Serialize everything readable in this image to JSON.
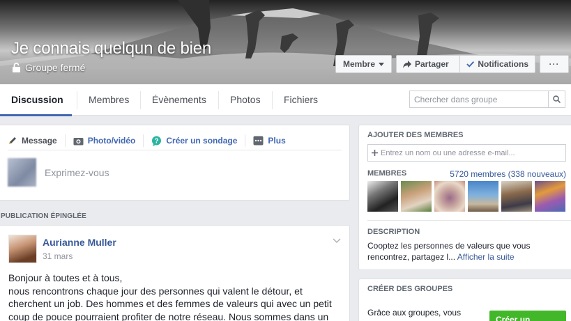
{
  "group": {
    "title": "Je connais quelqun de bien",
    "privacy": "Groupe fermé"
  },
  "cover_buttons": {
    "member": "Membre",
    "share": "Partager",
    "notifications": "Notifications",
    "more": "···"
  },
  "tabs": {
    "items": [
      "Discussion",
      "Membres",
      "Évènements",
      "Photos",
      "Fichiers"
    ],
    "active": "Discussion",
    "search_placeholder": "Chercher dans groupe"
  },
  "composer": {
    "tabs": [
      "Message",
      "Photo/vidéo",
      "Créer un sondage",
      "Plus"
    ],
    "placeholder": "Exprimez-vous"
  },
  "pinned": {
    "label": "PUBLICATION ÉPINGLÉE",
    "author": "Aurianne Muller",
    "date": "31 mars",
    "text_lines": [
      "Bonjour à toutes et à tous,",
      "nous rencontrons chaque jour des personnes qui valent le détour, et",
      "cherchent un job. Des hommes et des femmes de valeurs qui avec un petit",
      "coup de pouce pourraient profiter de notre réseau. Nous sommes dans un"
    ]
  },
  "sidebar": {
    "add_members_heading": "AJOUTER DES MEMBRES",
    "add_members_placeholder": "Entrez un nom ou une adresse e-mail...",
    "members_heading": "MEMBRES",
    "members_count": "5720 membres (338 nouveaux)",
    "description_heading": "DESCRIPTION",
    "description_text": "Cooptez les personnes de valeurs que vous rencontrez, partagez l...",
    "description_more": "Afficher la suite",
    "create_groups_heading": "CRÉER DES GROUPES",
    "create_groups_text": "Grâce aux groupes, vous",
    "create_group_button": "Créer un groupe"
  },
  "colors": {
    "accent": "#4267b2",
    "link": "#365899",
    "green": "#42b72a",
    "page_bg": "#e9ebee"
  }
}
